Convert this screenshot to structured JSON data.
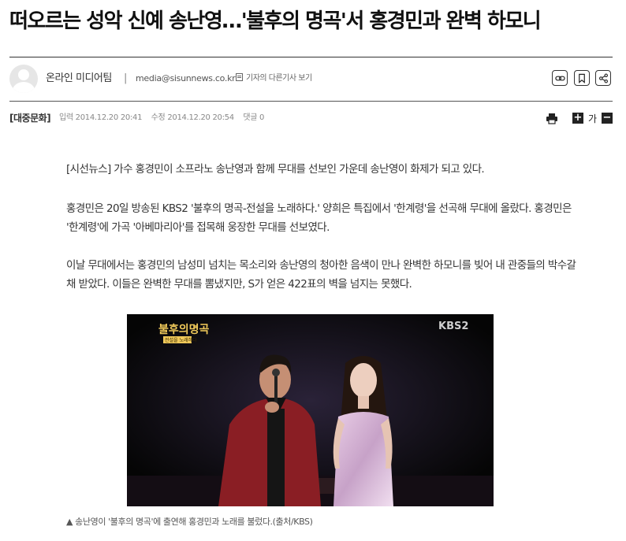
{
  "article": {
    "title": "떠오르는 성악 신예 송난영…'불후의 명곡'서 홍경민과 완벽 하모니",
    "author": "온라인 미디어팀",
    "separator": "|",
    "email": "media@sisunnews.co.kr",
    "other_articles_link": "기자의 다른기사 보기",
    "section": "[대중문화]",
    "published": "입력 2014.12.20 20:41",
    "modified": "수정 2014.12.20 20:54",
    "comments": "댓글 0",
    "font_size_label": "가",
    "font_increase": "+",
    "font_decrease": "−",
    "paragraphs": [
      "[시선뉴스] 가수 홍경민이 소프라노 송난영과 함께 무대를 선보인 가운데 송난영이 화제가 되고 있다.",
      "홍경민은 20일 방송된 KBS2 '불후의 명곡-전설을 노래하다.' 양희은 특집에서 '한계령'을 선곡해 무대에 올랐다. 홍경민은 '한계령'에 가곡 '아베마리아'를 접목해 웅장한 무대를 선보였다.",
      "이날 무대에서는 홍경민의 남성미 넘치는 목소리와 송난영의 청아한 음색이 만나 완벽한 하모니를 빚어 내 관중들의 박수갈채 받았다. 이들은 완벽한 무대를 뽐냈지만, S가 얻은 422표의 벽을 넘지는 못했다."
    ],
    "image": {
      "program_logo": "불후의명곡",
      "program_sub": "전설을 노래하다",
      "broadcaster_logo": "KBS2"
    },
    "caption": "▲ 송난영이 '불후의 명곡'에 출연해 홍경민과 노래를 불렀다.(출처/KBS)"
  },
  "icons": {
    "share_buttons": [
      "link-icon",
      "bookmark-icon",
      "share-icon"
    ],
    "print": "print-icon"
  }
}
